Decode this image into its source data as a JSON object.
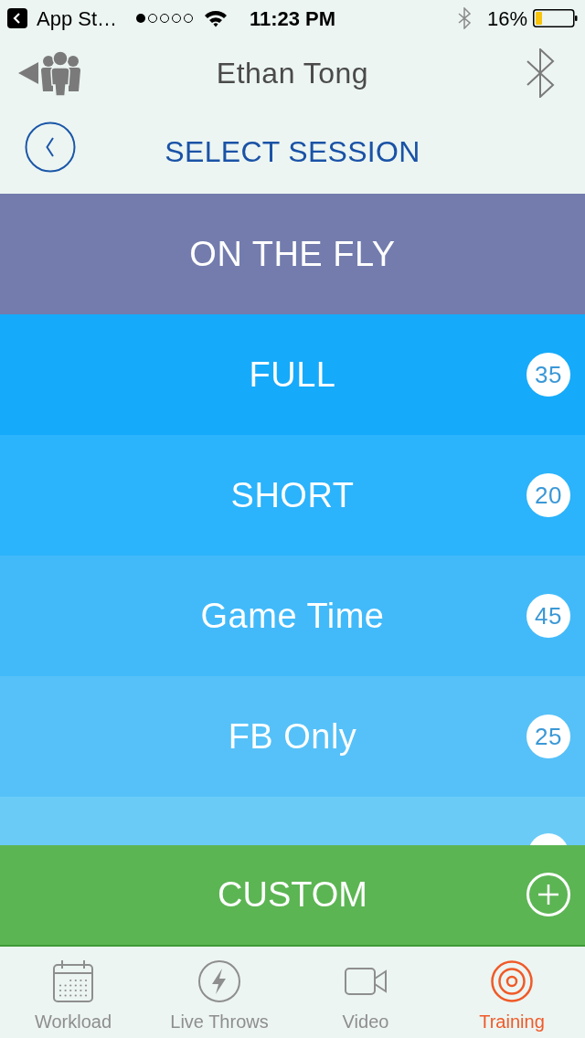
{
  "status_bar": {
    "back_app": "App St…",
    "time": "11:23 PM",
    "battery": "16%"
  },
  "header": {
    "user_name": "Ethan Tong",
    "title": "SELECT SESSION"
  },
  "sessions": [
    {
      "kind": "mode",
      "label": "ON THE FLY"
    },
    {
      "kind": "preset",
      "label": "FULL",
      "count": "35"
    },
    {
      "kind": "preset",
      "label": "SHORT",
      "count": "20"
    },
    {
      "kind": "preset",
      "label": "Game Time",
      "count": "45"
    },
    {
      "kind": "preset",
      "label": "FB Only",
      "count": "25"
    },
    {
      "kind": "covered"
    }
  ],
  "custom": {
    "label": "CUSTOM"
  },
  "tabs": [
    {
      "label": "Workload",
      "selected": false
    },
    {
      "label": "Live Throws",
      "selected": false
    },
    {
      "label": "Video",
      "selected": false
    },
    {
      "label": "Training",
      "selected": true
    }
  ]
}
